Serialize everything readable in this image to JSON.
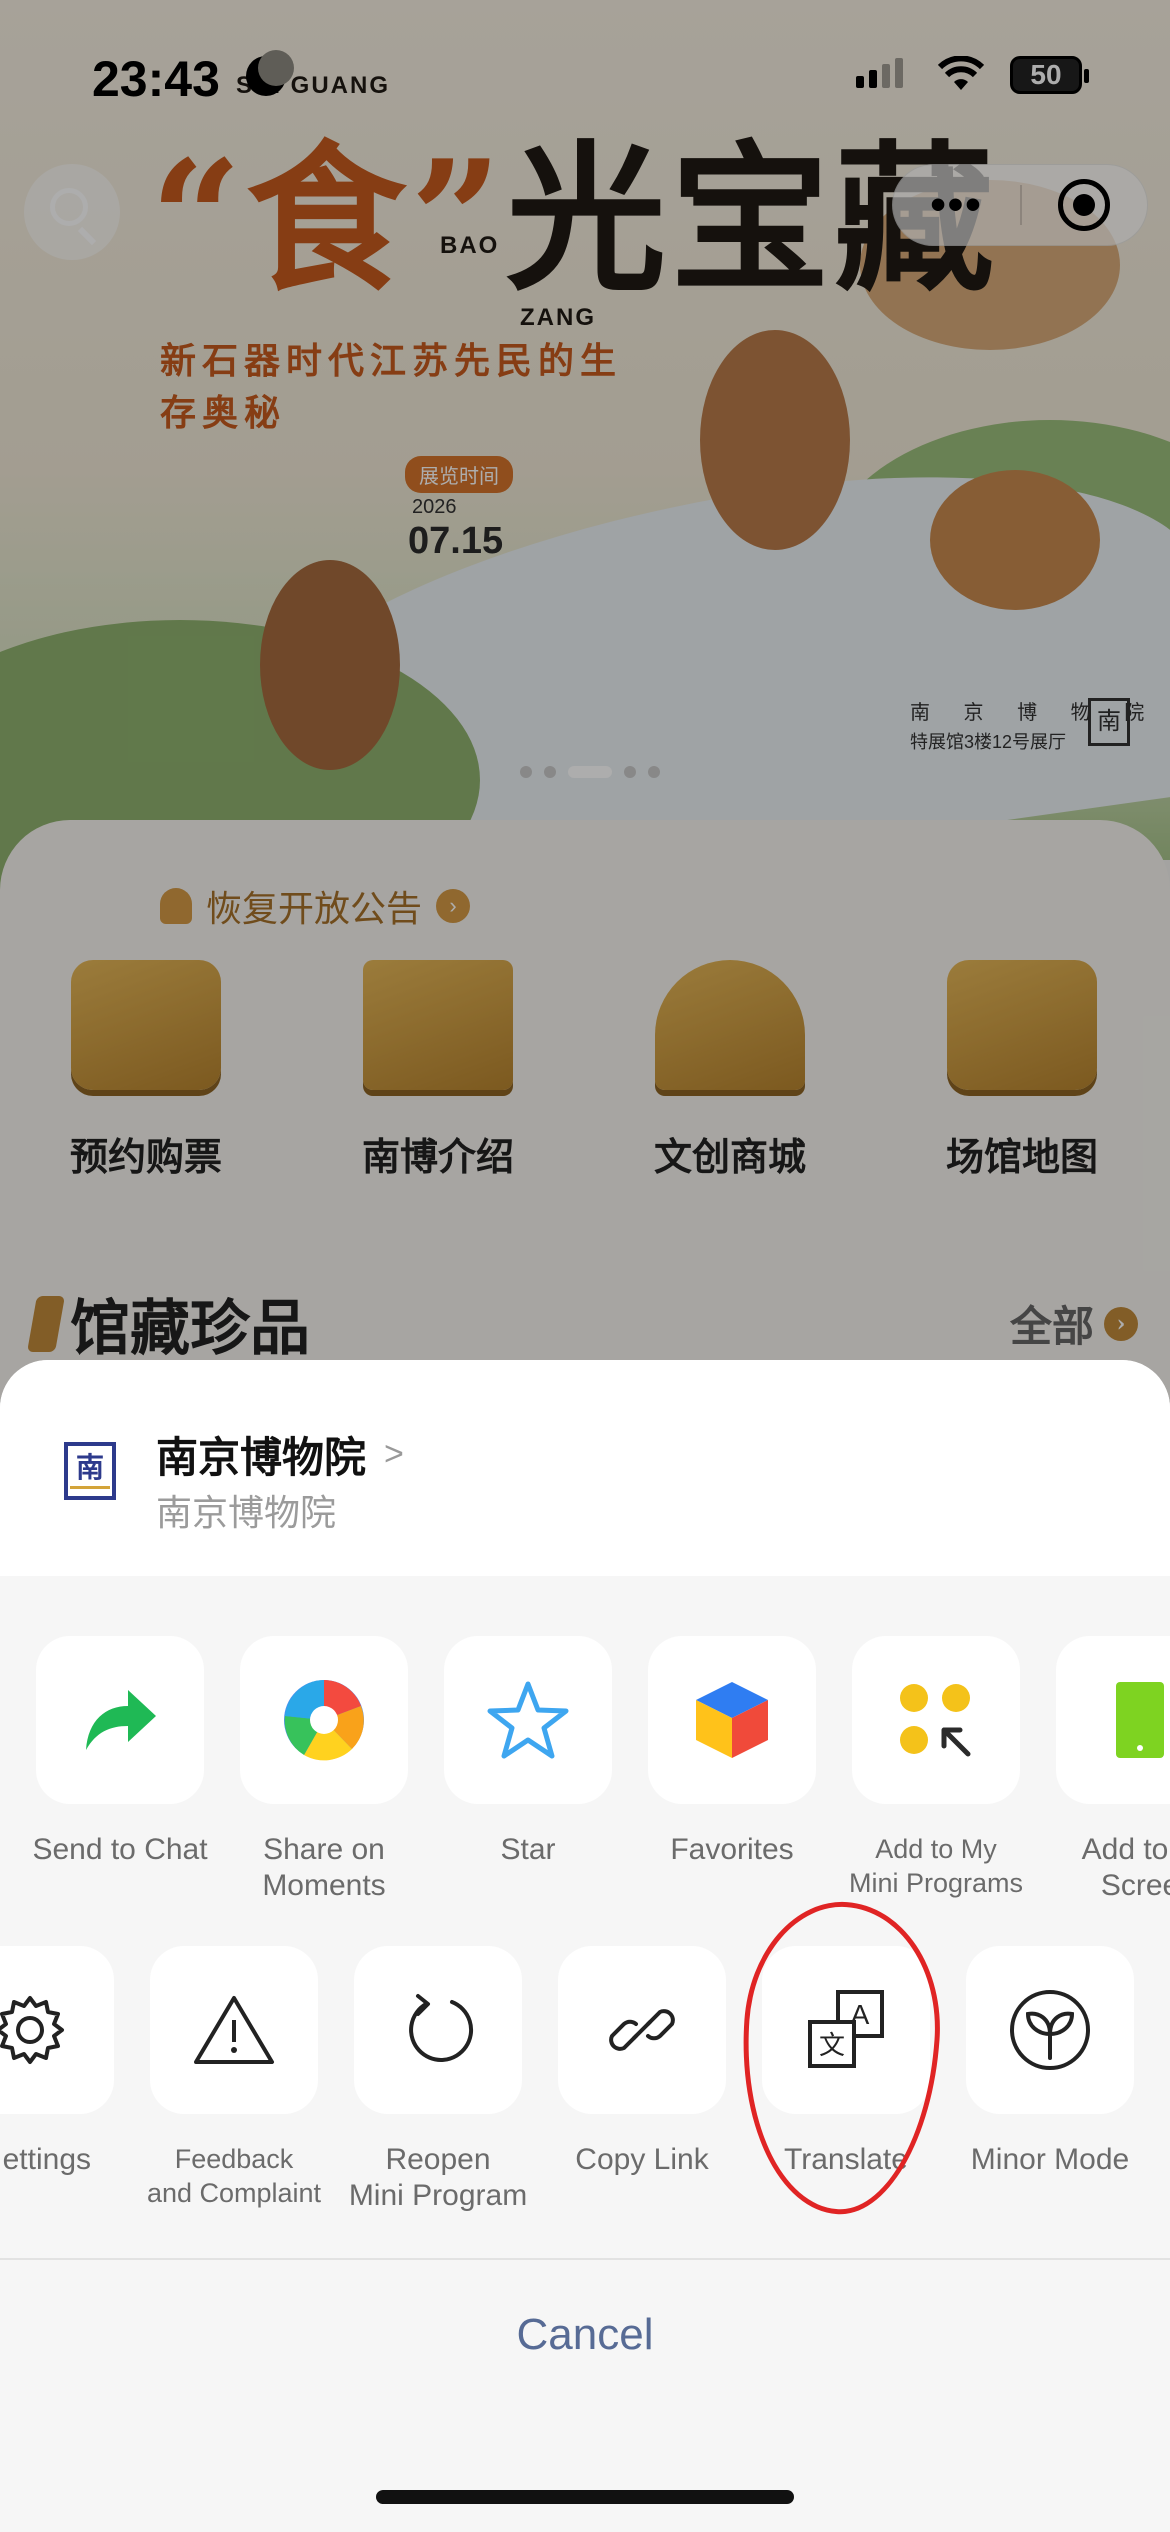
{
  "status_bar": {
    "time": "23:43",
    "battery": "50"
  },
  "banner": {
    "title_chars": [
      "“食”",
      "光",
      "宝",
      "藏"
    ],
    "roman_left": "SHI GUANG",
    "roman_bao": "BAO",
    "roman_zang": "ZANG",
    "subtitle": "新石器时代江苏先民的生存奥秘",
    "exhibit_time_label": "展览时间",
    "year": "2026",
    "date": "07.15",
    "venue_name": "南 京 博 物 院",
    "venue_hall": "特展馆3楼12号展厅",
    "seal": "南"
  },
  "notice": {
    "text": "恢复开放公告"
  },
  "features": [
    {
      "label": "预约购票"
    },
    {
      "label": "南博介绍"
    },
    {
      "label": "文创商城"
    },
    {
      "label": "场馆地图"
    }
  ],
  "collection": {
    "title": "馆藏珍品",
    "all_label": "全部"
  },
  "capsule": {
    "more": "•••"
  },
  "sheet": {
    "app_logo_glyph": "南",
    "app_name": "南京博物院",
    "app_chevron": ">",
    "app_subtitle": "南京博物院",
    "row1": [
      {
        "label": "Send to Chat",
        "icon": "share-arrow-icon"
      },
      {
        "label": "Share on\nMoments",
        "icon": "moments-aperture-icon"
      },
      {
        "label": "Star",
        "icon": "star-icon"
      },
      {
        "label": "Favorites",
        "icon": "favorites-cube-icon"
      },
      {
        "label": "Add to My\nMini Programs",
        "icon": "mini-programs-icon"
      },
      {
        "label": "Add to H\nScree",
        "icon": "home-screen-icon"
      }
    ],
    "row2": [
      {
        "label": "ettings",
        "icon": "gear-icon"
      },
      {
        "label": "Feedback\nand Complaint",
        "icon": "warning-triangle-icon"
      },
      {
        "label": "Reopen\nMini Program",
        "icon": "reload-icon"
      },
      {
        "label": "Copy Link",
        "icon": "link-icon"
      },
      {
        "label": "Translate",
        "icon": "translate-icon"
      },
      {
        "label": "Minor Mode",
        "icon": "sprout-icon"
      }
    ],
    "translate_glyph_a": "A",
    "translate_glyph_wen": "文",
    "cancel": "Cancel"
  },
  "colors": {
    "accent_link": "#576b95",
    "annotation": "#e02424",
    "share_green": "#1fb955"
  }
}
